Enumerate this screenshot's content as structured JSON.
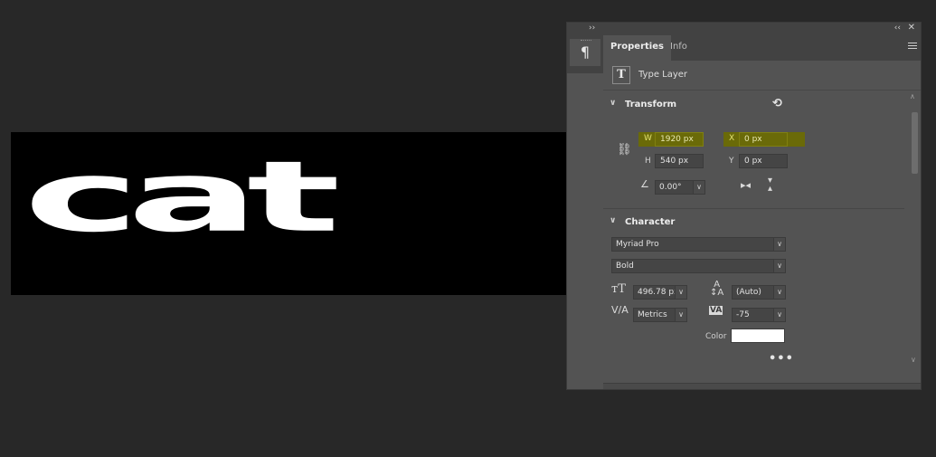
{
  "canvas": {
    "text": "cat"
  },
  "panel": {
    "topbar": {
      "expand_glyph": "››",
      "collapse_glyph": "‹‹",
      "close_glyph": "✕"
    },
    "side_dock": {
      "paragraph_glyph": "¶"
    },
    "tabs": [
      {
        "label": "Properties",
        "active": true
      },
      {
        "label": "Info",
        "active": false
      }
    ],
    "type_layer": {
      "icon": "T",
      "label": "Type Layer"
    },
    "transform": {
      "title": "Transform",
      "w_label": "W",
      "w_value": "1920 px",
      "h_label": "H",
      "h_value": "540 px",
      "x_label": "X",
      "x_value": "0 px",
      "y_label": "Y",
      "y_value": "0 px",
      "angle_value": "0.00°"
    },
    "character": {
      "title": "Character",
      "font_family": "Myriad Pro",
      "font_style": "Bold",
      "font_size": "496.78 px",
      "leading": "(Auto)",
      "kerning": "Metrics",
      "tracking": "-75",
      "color_label": "Color",
      "color_value": "#ffffff",
      "more_glyph": "•••"
    }
  },
  "colors": {
    "highlight": "#6a6a08",
    "panel_bg": "#535353",
    "app_bg": "#282828"
  }
}
